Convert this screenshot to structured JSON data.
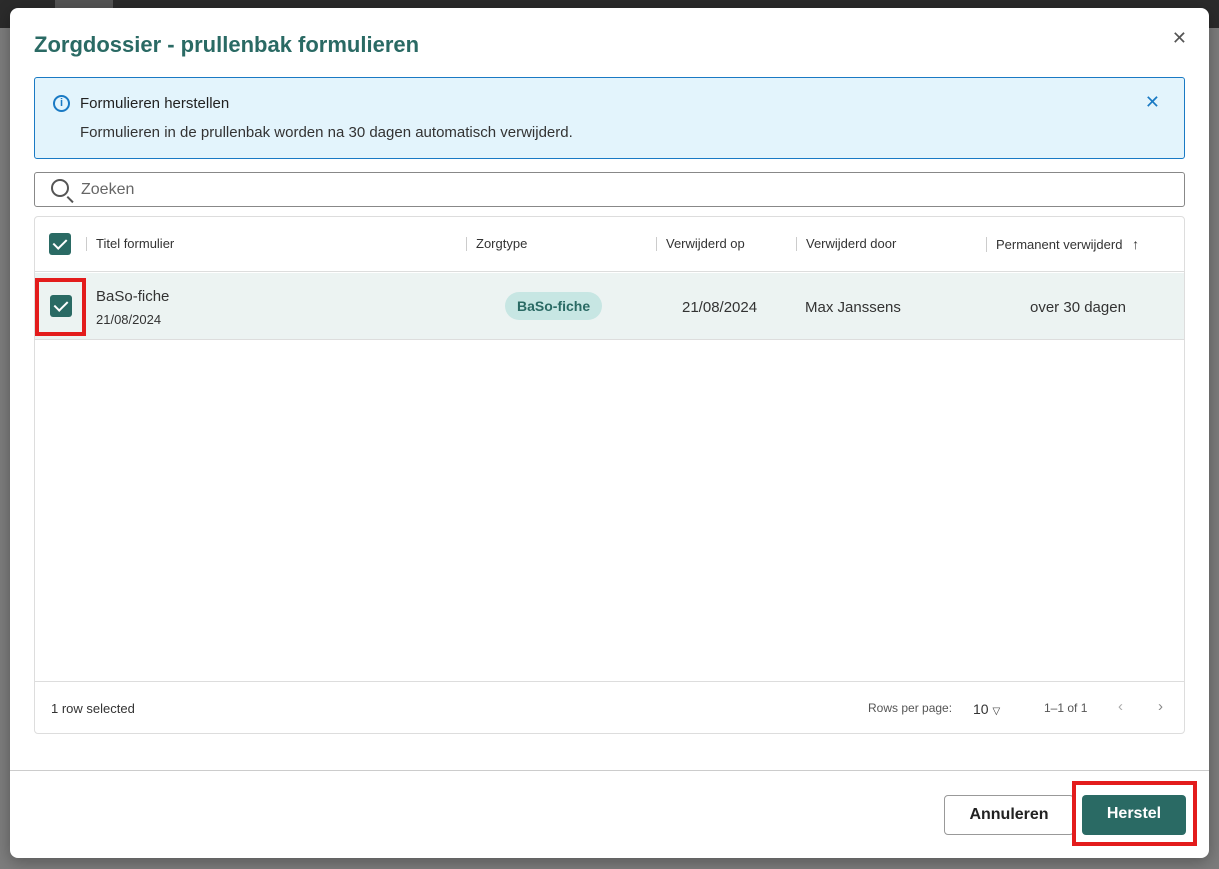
{
  "dialog": {
    "title": "Zorgdossier - prullenbak formulieren",
    "close_icon": "close-icon"
  },
  "info": {
    "title": "Formulieren herstellen",
    "body": "Formulieren in de prullenbak worden na 30 dagen automatisch verwijderd.",
    "icon": "info-icon",
    "color": "#1a7ac4"
  },
  "search": {
    "placeholder": "Zoeken",
    "value": ""
  },
  "table": {
    "columns": [
      "Titel formulier",
      "Zorgtype",
      "Verwijderd op",
      "Verwijderd door",
      "Permanent verwijderd"
    ],
    "sort": {
      "column": "Permanent verwijderd",
      "direction": "ascending"
    },
    "rows": [
      {
        "selected": true,
        "title": "BaSo-fiche",
        "date": "21/08/2024",
        "zorgtype": "BaSo-fiche",
        "verwijderd_op": "21/08/2024",
        "verwijderd_door": "Max Janssens",
        "permanent": "over 30 dagen"
      }
    ],
    "footer": {
      "selected_text": "1 row selected",
      "rows_per_page_label": "Rows per page:",
      "rows_per_page": "10",
      "range": "1–1 of 1"
    }
  },
  "buttons": {
    "cancel": "Annuleren",
    "restore": "Herstel"
  },
  "colors": {
    "accent": "#2a6a64",
    "highlight": "#e31c1c"
  }
}
